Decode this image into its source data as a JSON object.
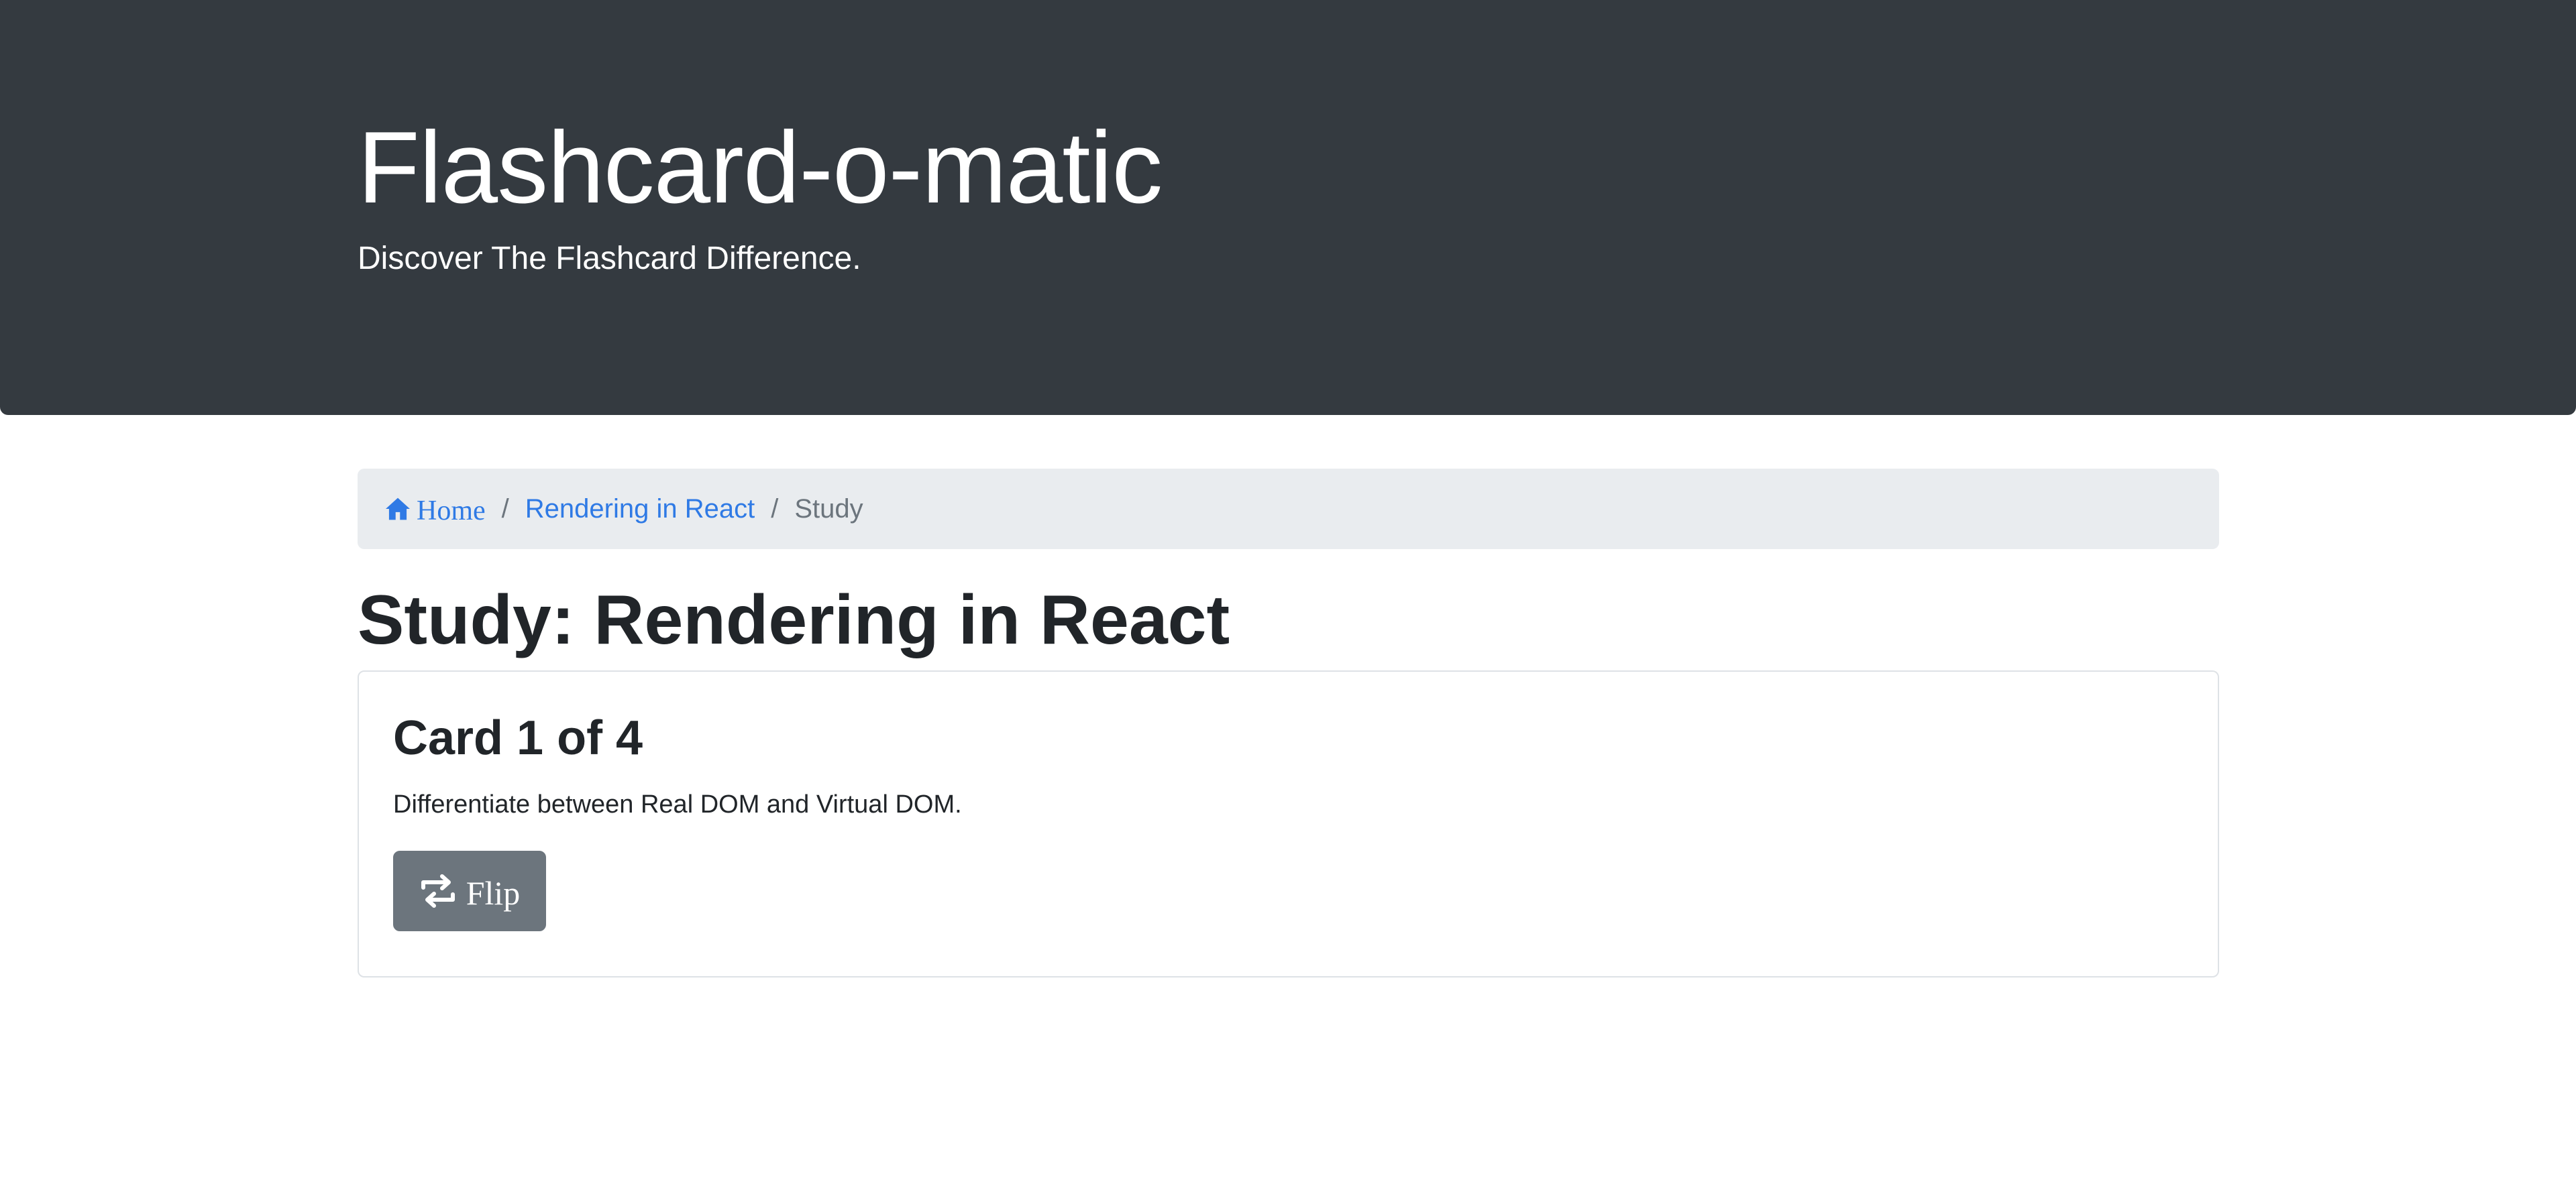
{
  "header": {
    "title": "Flashcard-o-matic",
    "subtitle": "Discover The Flashcard Difference."
  },
  "breadcrumb": {
    "home_icon": "home-icon",
    "home_label": "Home",
    "deck_label": "Rendering in React",
    "current_label": "Study",
    "separator": "/"
  },
  "page": {
    "title": "Study: Rendering in React"
  },
  "card": {
    "counter": "Card 1 of 4",
    "front_text": "Differentiate between Real DOM and Virtual DOM.",
    "flip_icon": "flip-arrows-icon",
    "flip_label": "Flip"
  },
  "colors": {
    "header_bg": "#343a40",
    "link": "#2f7ae5",
    "breadcrumb_bg": "#e9ecef",
    "secondary_button": "#6c757d",
    "text": "#212529"
  }
}
